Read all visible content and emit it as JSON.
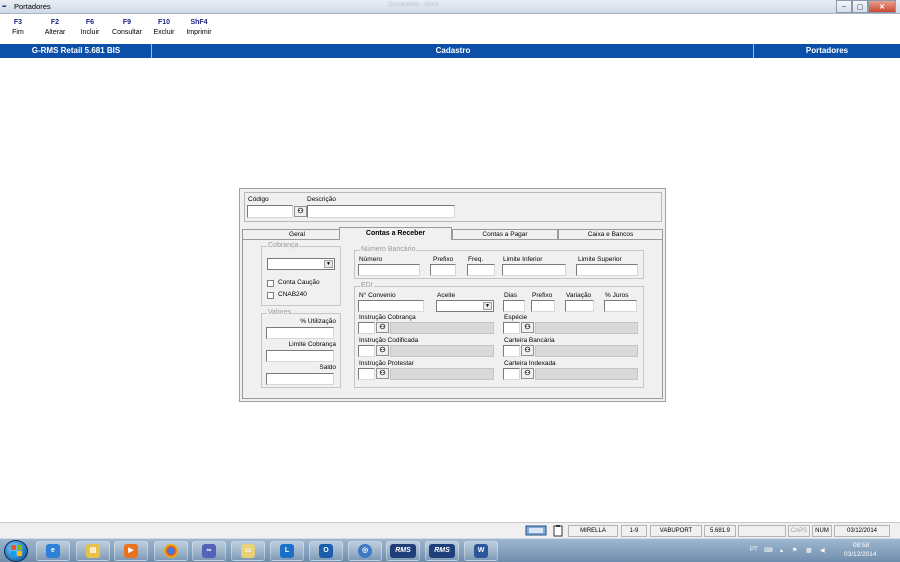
{
  "window": {
    "title": "Portadores",
    "ghost_title": "Documento - Word",
    "controls": [
      "–",
      "▢",
      "✕"
    ]
  },
  "fkeys": [
    {
      "key": "F3",
      "label": "Fim"
    },
    {
      "key": "F2",
      "label": "Alterar"
    },
    {
      "key": "F6",
      "label": "Incluir"
    },
    {
      "key": "F9",
      "label": "Consultar"
    },
    {
      "key": "F10",
      "label": "Excluir"
    },
    {
      "key": "ShF4",
      "label": "Imprimir"
    }
  ],
  "band": {
    "left": "G-RMS Retail 5.681 BIS",
    "center": "Cadastro",
    "right": "Portadores",
    "color": "#0b4fa8"
  },
  "form": {
    "codigo_label": "Código",
    "codigo_value": "",
    "descricao_label": "Descrição",
    "descricao_value": "",
    "tabs": [
      "Geral",
      "Contas a Receber",
      "Contas a Pagar",
      "Caixa e Bancos"
    ],
    "active_tab": "Contas a Receber",
    "cobranca": {
      "caption": "Cobrança",
      "selected": "",
      "conta_caucao": "Conta Caução",
      "cnab240": "CNAB240"
    },
    "valores": {
      "caption": "Valores",
      "utilizacao": "% Utilização",
      "limite_cobranca": "Limite Cobrança",
      "saldo": "Saldo"
    },
    "numero_bancario": {
      "caption": "Número Bancário",
      "numero": "Número",
      "prefixo": "Prefixo",
      "freq": "Freq.",
      "limite_inferior": "Limite Inferior",
      "limite_superior": "Limite Superior"
    },
    "edi": {
      "caption": "EDI",
      "convenio": "N° Convenio",
      "aceite": "Aceite",
      "dias": "Dias",
      "prefixo": "Prefixo",
      "variacao": "Variação",
      "juros": "% Juros",
      "instrucao_cobranca": "Instrução Cobrança",
      "especie": "Espécie",
      "instrucao_codificada": "Instrução Codificada",
      "carteira_bancaria": "Carteira Bancária",
      "instrucao_protestar": "Instrução Protestar",
      "carteira_indexada": "Carteira Indexada"
    }
  },
  "status": {
    "user": "MIRELLA",
    "range": "1-9",
    "program": "VABUPORT",
    "version": "5.681.9",
    "caps": "CAPS",
    "num": "NUM",
    "date": "03/12/2014"
  },
  "taskbar": {
    "apps": [
      "ie-icon",
      "explorer-icon",
      "media-player-icon",
      "chrome-icon",
      "network-icon",
      "folder-icon",
      "lync-icon",
      "outlook-icon",
      "vm-icon",
      "rms-icon",
      "rms-icon",
      "word-icon"
    ],
    "rms_label": "RMS",
    "lang": "PT",
    "time": "08:58",
    "date": "03/12/2014"
  }
}
